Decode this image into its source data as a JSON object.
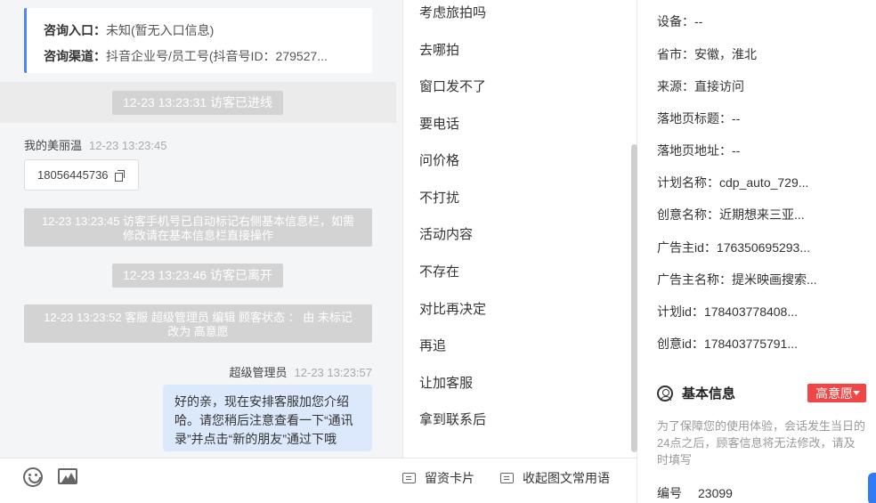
{
  "info_card": {
    "entry_label": "咨询入口：",
    "entry_value": "未知(暂无入口信息)",
    "channel_label": "咨询渠道：",
    "channel_value": "抖音企业号/员工号(抖音号ID：279527..."
  },
  "messages": {
    "sys_enter": "12-23 13:23:31 访客已进线",
    "visitor_name": "我的美丽温",
    "visitor_time": "12-23 13:23:45",
    "phone": "18056445736",
    "sys_phone_tag": "12-23 13:23:45 访客手机号已自动标记右侧基本信息栏，如需修改请在基本信息栏直接操作",
    "sys_leave": "12-23 13:23:46 访客已离开",
    "sys_status": "12-23 13:23:52 客服 超级管理员 编辑 顾客状态 ： 由 未标记 改为 高意愿",
    "agent_name": "超级管理员",
    "agent_time": "12-23 13:23:57",
    "agent_text": "好的亲，现在安排客服加您介绍哈。请您稍后注意查看一下“通讯录”并点击“新的朋友”通过下哦"
  },
  "quick_phrases": [
    "考虑旅拍吗",
    "去哪拍",
    "窗口发不了",
    "要电话",
    "问价格",
    "不打扰",
    "活动内容",
    "不存在",
    "对比再决定",
    "再追",
    "让加客服",
    "拿到联系后"
  ],
  "toolbar": {
    "lead_card": "留资卡片",
    "collapse": "收起图文常用语"
  },
  "visitor_info": [
    {
      "label": "设备：",
      "value": "--"
    },
    {
      "label": "省市：",
      "value": "安徽，淮北"
    },
    {
      "label": "来源：",
      "value": "直接访问"
    },
    {
      "label": "落地页标题：",
      "value": "--"
    },
    {
      "label": "落地页地址：",
      "value": "--"
    },
    {
      "label": "计划名称：",
      "value": "cdp_auto_729..."
    },
    {
      "label": "创意名称：",
      "value": "近期想来三亚..."
    },
    {
      "label": "广告主id：",
      "value": "176350695293..."
    },
    {
      "label": "广告主名称：",
      "value": "提米映画搜索..."
    },
    {
      "label": "计划id：",
      "value": "178403778408..."
    },
    {
      "label": "创意id：",
      "value": "178403775791..."
    }
  ],
  "basic_info": {
    "title": "基本信息",
    "intent": "高意愿",
    "notice": "为了保障您的使用体验，会话发生当日的24点之后，顾客信息将无法修改，请及时填写",
    "id_label": "编号",
    "id_value": "23099"
  },
  "colors": {
    "accent": "#4d88f0",
    "agent_bubble": "#dce9fc",
    "system_msg": "#d3d3d3",
    "intent_badge": "#f04646"
  }
}
